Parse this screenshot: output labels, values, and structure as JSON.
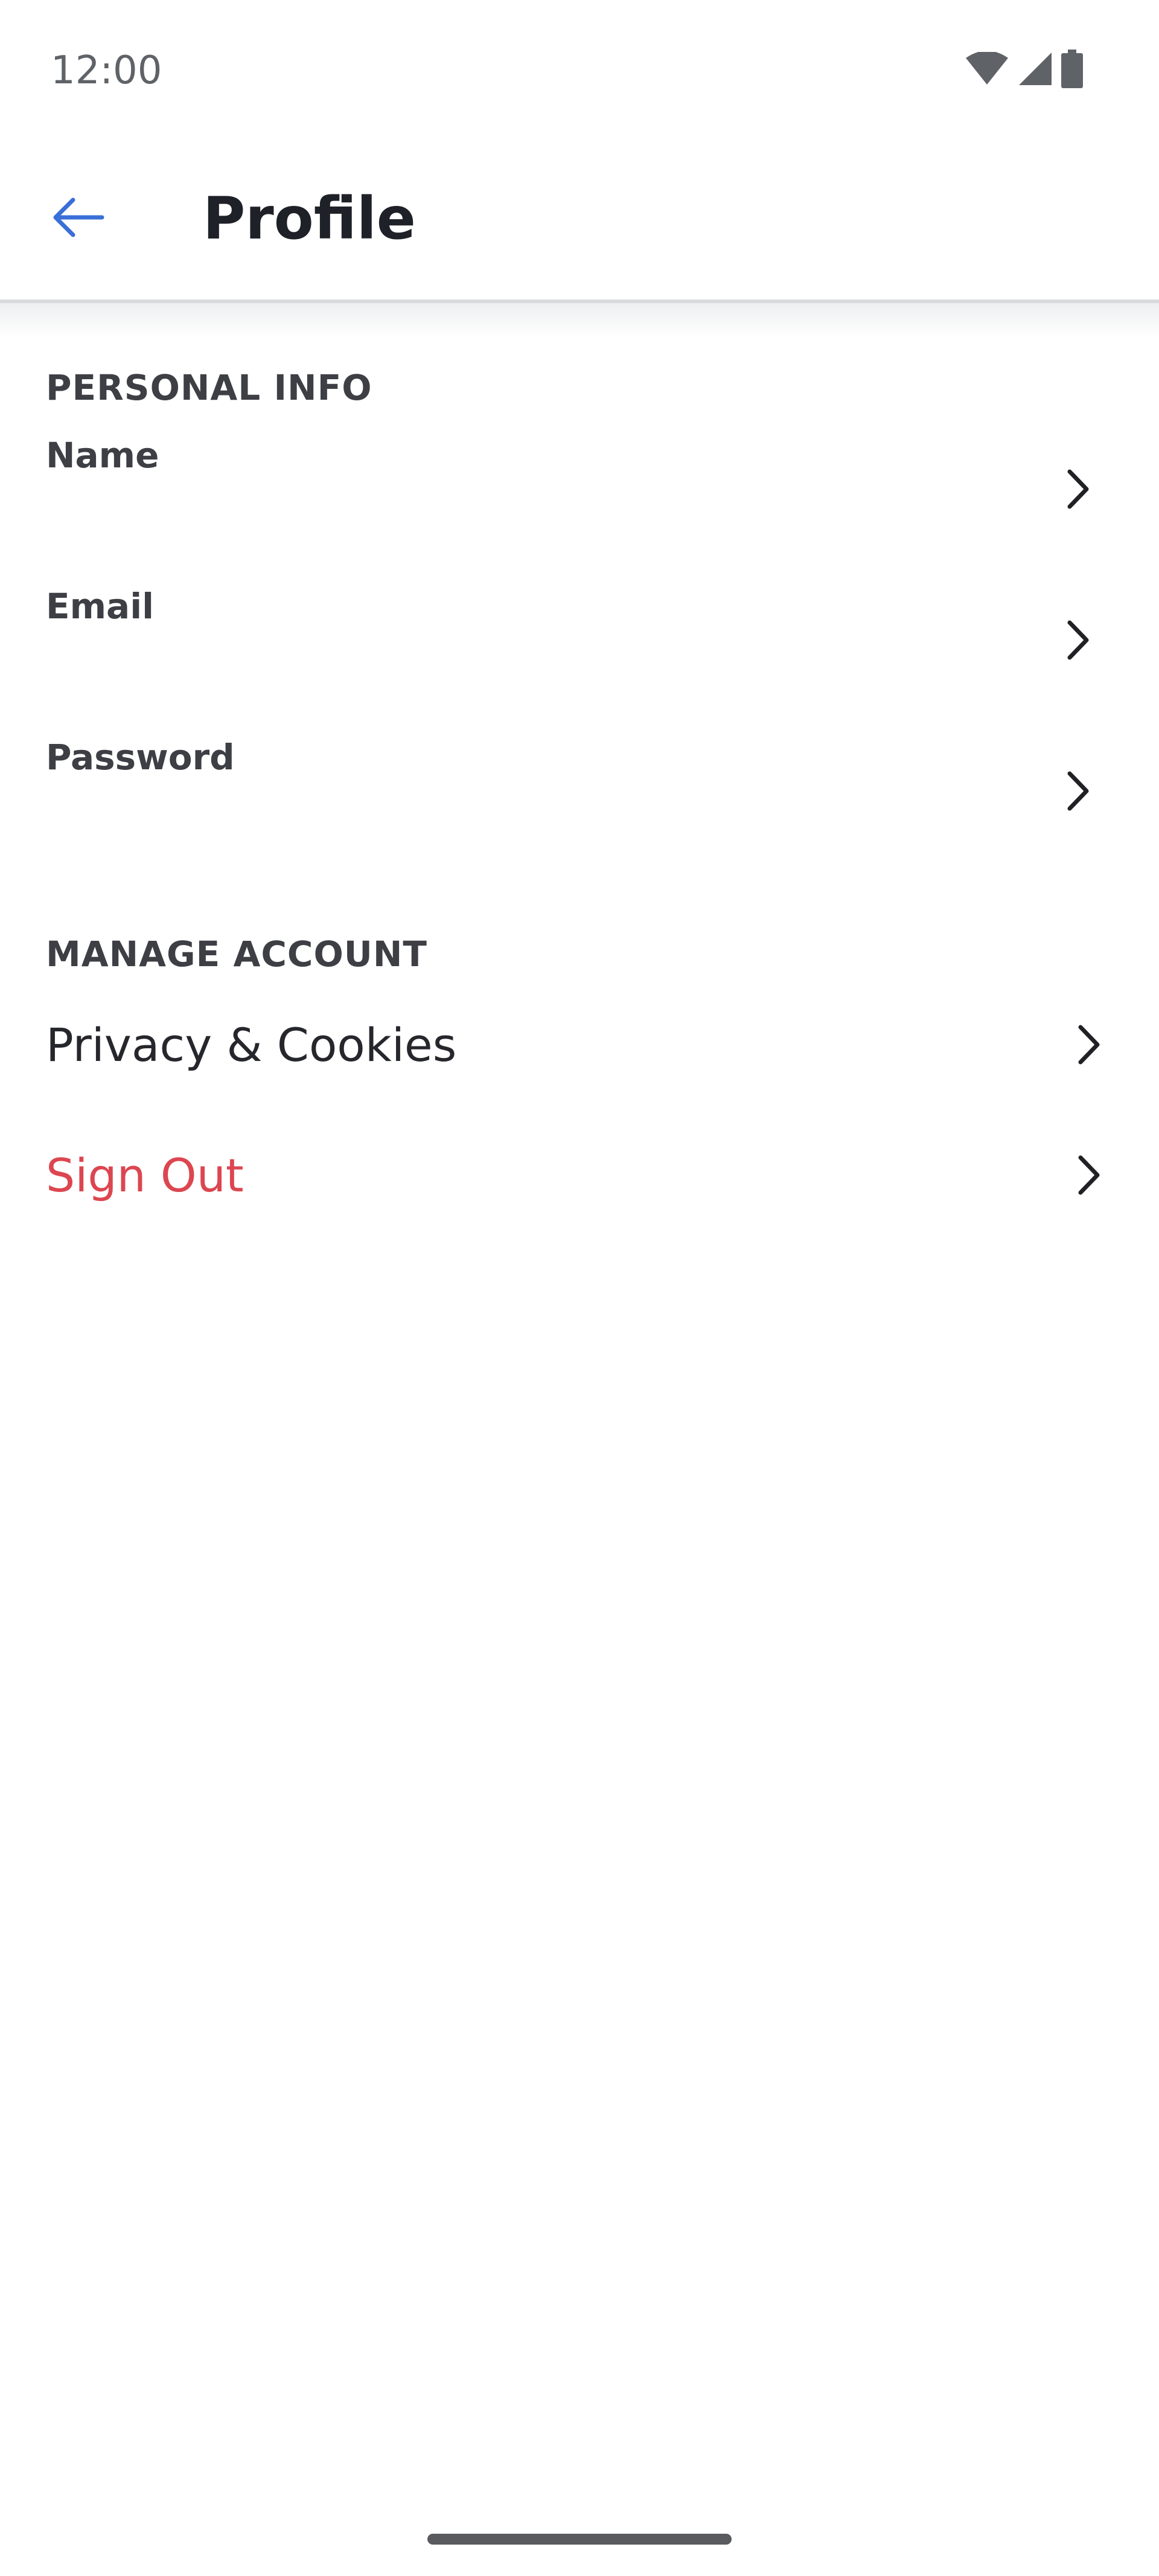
{
  "status_bar": {
    "time": "12:00",
    "icons": [
      "wifi-icon",
      "cell-signal-icon",
      "battery-icon"
    ]
  },
  "app_bar": {
    "title": "Profile",
    "back_icon": "arrow-left-icon",
    "accent_color": "#3a6fd8"
  },
  "personal_info": {
    "header": "PERSONAL INFO",
    "items": [
      {
        "label": "Name"
      },
      {
        "label": "Email"
      },
      {
        "label": "Password"
      }
    ]
  },
  "manage_account": {
    "header": "MANAGE ACCOUNT",
    "items": [
      {
        "label": "Privacy & Cookies"
      },
      {
        "label": "Sign Out",
        "color": "#dc4650"
      }
    ]
  }
}
